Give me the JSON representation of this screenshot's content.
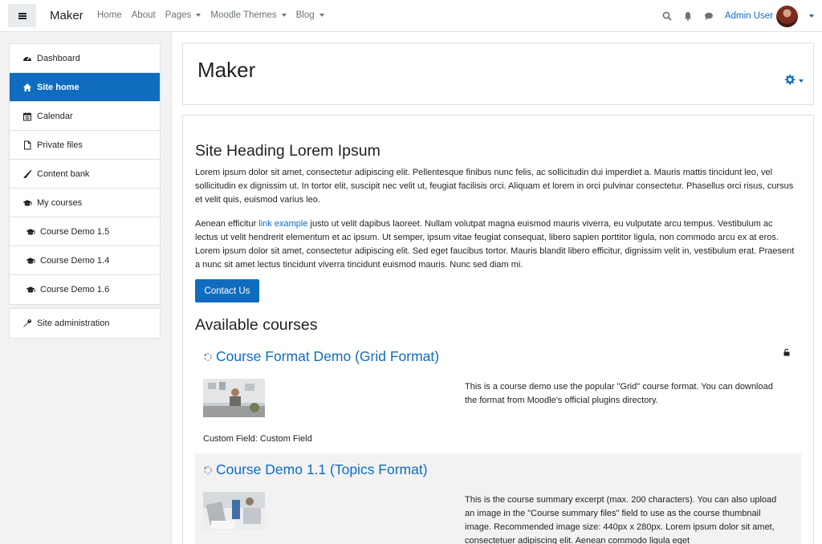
{
  "navbar": {
    "brand": "Maker",
    "links": [
      {
        "label": "Home",
        "has_caret": false
      },
      {
        "label": "About",
        "has_caret": false
      },
      {
        "label": "Pages",
        "has_caret": true
      },
      {
        "label": "Moodle Themes",
        "has_caret": true
      },
      {
        "label": "Blog",
        "has_caret": true
      }
    ],
    "icons": [
      "search-icon",
      "bell-icon",
      "chat-icon"
    ],
    "user_name": "Admin User"
  },
  "sidebar": {
    "groups": [
      [
        {
          "label": "Dashboard",
          "icon": "dashboard-icon",
          "active": false,
          "indent": false
        },
        {
          "label": "Site home",
          "icon": "home-icon",
          "active": true,
          "indent": false
        },
        {
          "label": "Calendar",
          "icon": "calendar-icon",
          "active": false,
          "indent": false
        },
        {
          "label": "Private files",
          "icon": "file-icon",
          "active": false,
          "indent": false
        },
        {
          "label": "Content bank",
          "icon": "brush-icon",
          "active": false,
          "indent": false
        },
        {
          "label": "My courses",
          "icon": "graduation-cap-icon",
          "active": false,
          "indent": false
        },
        {
          "label": "Course Demo 1.5",
          "icon": "graduation-cap-icon",
          "active": false,
          "indent": true
        },
        {
          "label": "Course Demo 1.4",
          "icon": "graduation-cap-icon",
          "active": false,
          "indent": true
        },
        {
          "label": "Course Demo 1.6",
          "icon": "graduation-cap-icon",
          "active": false,
          "indent": true
        }
      ],
      [
        {
          "label": "Site administration",
          "icon": "wrench-icon",
          "active": false,
          "indent": false
        }
      ]
    ]
  },
  "header": {
    "title": "Maker"
  },
  "content": {
    "heading": "Site Heading Lorem Ipsum",
    "para1": "Lorem ipsum dolor sit amet, consectetur adipiscing elit. Pellentesque finibus nunc felis, ac sollicitudin dui imperdiet a. Mauris mattis tincidunt leo, vel sollicitudin ex dignissim ut. In tortor elit, suscipit nec velit ut, feugiat facilisis orci. Aliquam et lorem in orci pulvinar consectetur. Phasellus orci risus, cursus et velit quis, euismod varius leo.",
    "para2_before": "Aenean efficitur ",
    "para2_link": "link example",
    "para2_after": " justo ut velit dapibus laoreet. Nullam volutpat magna euismod mauris viverra, eu vulputate arcu tempus. Vestibulum ac lectus ut velit hendrerit elementum et ac ipsum. Ut semper, ipsum vitae feugiat consequat, libero sapien porttitor ligula, non commodo arcu ex at eros. Lorem ipsum dolor sit amet, consectetur adipiscing elit. Sed eget faucibus tortor. Mauris blandit libero efficitur, dignissim velit in, vestibulum erat. Praesent a nunc sit amet lectus tincidunt viverra tincidunt euismod mauris. Nunc sed diam mi.",
    "contact_button": "Contact Us",
    "available_heading": "Available courses"
  },
  "courses": [
    {
      "title": "Course Format Demo (Grid Format)",
      "summary": "This is a course demo use the popular \"Grid\" course format. You can download the format from Moodle's official plugins directory.",
      "custom_field": "Custom Field: Custom Field"
    },
    {
      "title": "Course Demo 1.1 (Topics Format)",
      "summary": "This is the course summary excerpt (max. 200 characters). You can also upload an image in the \"Course summary files\" field to use as the course thumbnail image. Recommended image size: 440px x 280px. Lorem ipsum dolor sit amet, consectetuer adipiscing elit. Aenean commodo ligula eget"
    }
  ],
  "colors": {
    "accent": "#0f6cbf",
    "text": "#1d2125",
    "muted": "#6a737b",
    "sidebar_bg": "#f2f2f2"
  }
}
